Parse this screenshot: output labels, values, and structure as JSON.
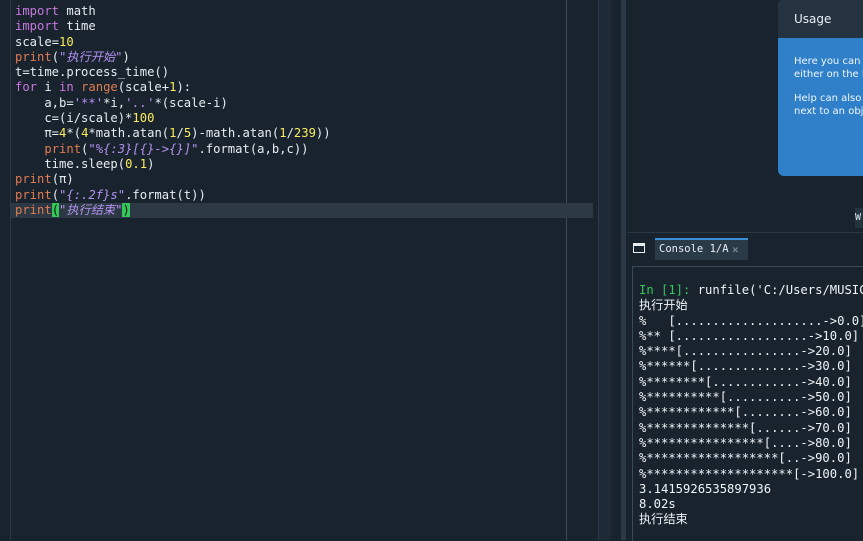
{
  "editor": {
    "lines": [
      [
        "kw:import",
        " math"
      ],
      [
        "kw:import",
        " time"
      ],
      [
        "scale=",
        "num:10"
      ],
      [
        "bi:print",
        "(",
        "str:\"",
        "cjk:执行开始",
        "str:\"",
        ")"
      ],
      [
        "t=time.process_time()"
      ],
      [
        "kw:for",
        " i ",
        "kw:in",
        " ",
        "bi:range",
        "(scale+",
        "num:1",
        "):"
      ],
      [
        "    a,b=",
        "str:'**'",
        "*i,",
        "str:'..'",
        "*(scale-i)"
      ],
      [
        "    c=(i/scale)*",
        "num:100"
      ],
      [
        "    π=",
        "num:4",
        "*(",
        "num:4",
        "*math.atan(",
        "num:1",
        "/",
        "num:5",
        ")-math.atan(",
        "num:1",
        "/",
        "num:239",
        "))"
      ],
      [
        "    ",
        "bi:print",
        "(",
        "str:\"%{:3}[{}->{}]\"",
        ".format(a,b,c))"
      ],
      [
        "    time.sleep(",
        "num:0.1",
        ")"
      ],
      [
        "bi:print",
        "(π)"
      ],
      [
        "bi:print",
        "(",
        "str:\"{:.2f}s\"",
        ".format(t))"
      ],
      [
        "bi:print",
        "bm:(",
        "str:\"",
        "cjk:执行结束",
        "str:\"",
        "bm:)"
      ]
    ],
    "current_line": 13
  },
  "help": {
    "usage_title": "Usage",
    "usage_text_1a": "Here you can g",
    "usage_text_1b": "either on the E",
    "usage_text_2a": "Help can also b",
    "usage_text_2b": "next to an obje",
    "corner_glyph": "W"
  },
  "console": {
    "tab_label": "Console 1/A",
    "prompt": "In [1]:",
    "command": " runfile('C:/Users/MUSIC/",
    "output": [
      "执行开始",
      "%   [....................->0.0]",
      "%** [..................->10.0]",
      "%****[................->20.0]",
      "%******[..............->30.0]",
      "%********[............->40.0]",
      "%**********[..........->50.0]",
      "%************[........->60.0]",
      "%**************[......->70.0]",
      "%****************[....->80.0]",
      "%******************[..->90.0]",
      "%********************[->100.0]",
      "3.1415926535897936",
      "8.02s",
      "执行结束"
    ]
  }
}
